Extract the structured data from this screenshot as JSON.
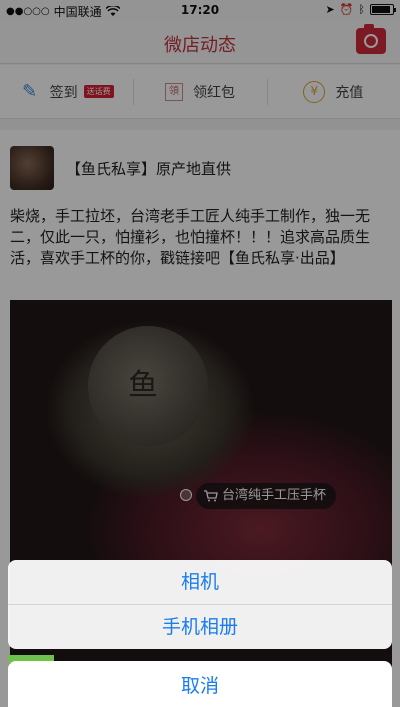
{
  "status_bar": {
    "signal": "●●○○○",
    "carrier": "中国联通",
    "wifi_icon": "wifi-icon",
    "time": "17:20",
    "icons": [
      "location-icon",
      "alarm-icon",
      "bluetooth-icon"
    ],
    "battery_level": 0.9
  },
  "nav": {
    "title": "微店动态",
    "right_icon": "camera-icon",
    "accent_color": "#c2323f"
  },
  "actions": [
    {
      "label": "签到",
      "icon": "feather-icon",
      "badge": "送话费"
    },
    {
      "label": "领红包",
      "icon": "red-envelope-icon"
    },
    {
      "label": "充值",
      "icon": "yen-icon",
      "glyph": "¥"
    }
  ],
  "post": {
    "shop_name": "【鱼氏私享】原产地直供",
    "text": "柴烧，手工拉坯，台湾老手工匠人纯手工制作，独一无二，仅此一只，怕撞衫，也怕撞杯！！！追求高品质生活，喜欢手工杯的你，戳链接吧【鱼氏私享·出品】",
    "product_tag": "台湾纯手工压手杯",
    "product_tag_icon": "cart-icon"
  },
  "action_sheet": {
    "options": [
      "相机",
      "手机相册"
    ],
    "cancel": "取消",
    "text_color": "#1a7cf1"
  }
}
